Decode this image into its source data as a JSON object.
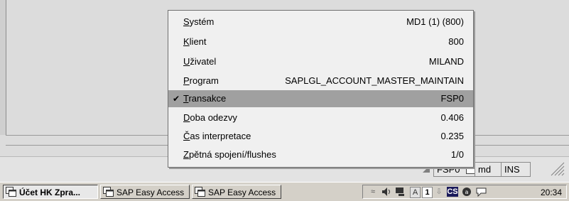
{
  "context_menu": {
    "items": [
      {
        "label": "Systém",
        "value": "MD1 (1) (800)",
        "checked": false
      },
      {
        "label": "Klient",
        "value": "800",
        "checked": false
      },
      {
        "label": "Uživatel",
        "value": "MILAND",
        "checked": false
      },
      {
        "label": "Program",
        "value": "SAPLGL_ACCOUNT_MASTER_MAINTAIN",
        "checked": false
      },
      {
        "label": "Transakce",
        "value": "FSP0",
        "checked": true
      },
      {
        "label": "Doba odezvy",
        "value": "0.406",
        "checked": false
      },
      {
        "label": "Čas interpretace",
        "value": "0.235",
        "checked": false
      },
      {
        "label": "Zpětná spojení/flushes",
        "value": "1/0",
        "checked": false
      }
    ],
    "check_mark": "✔"
  },
  "status_bar": {
    "transaction": "FSP0",
    "server": "md",
    "mode": "INS"
  },
  "taskbar": {
    "buttons": [
      {
        "label": "Účet HK Zpra...",
        "active": true
      },
      {
        "label": "SAP Easy Access",
        "active": false
      },
      {
        "label": "SAP Easy Access",
        "active": false
      }
    ],
    "tray": {
      "lang": "CS",
      "a_label": "A",
      "one_label": "1",
      "clock": "20:34"
    }
  },
  "colors": {
    "menu_bg": "#f0f0f0",
    "menu_selected": "#a0a0a0",
    "window_bg": "#dcdcdc",
    "taskbar_bg": "#d4d0c8",
    "tray_cs_bg": "#000080"
  }
}
